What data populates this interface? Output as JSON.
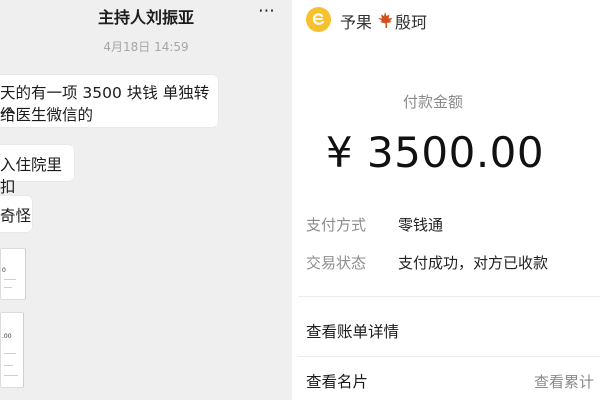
{
  "chat": {
    "title": "主持人刘振亚",
    "more_icon": "⋯",
    "timestamp": "4月18日 14:59",
    "messages": [
      {
        "line1": "天的有一项 3500 块钱 单独转给",
        "line2": "个医生微信的"
      },
      {
        "text": "入住院里扣"
      },
      {
        "text": "奇怪"
      }
    ],
    "thumbnails": [
      {
        "text1": "0",
        "text2": ""
      },
      {
        "text1": ".00",
        "text2": ""
      }
    ]
  },
  "receipt": {
    "merchant_name_part1": "予果",
    "merchant_name_part2": "殷珂",
    "amount_label": "付款金额",
    "amount": "¥ 3500.00",
    "payment_method_label": "支付方式",
    "payment_method_value": "零钱通",
    "status_label": "交易状态",
    "status_value": "支付成功，对方已收款",
    "bill_detail": "查看账单详情",
    "view_card": "查看名片",
    "view_total": "查看累计",
    "colors": {
      "avatar": "#f6c02e",
      "maple": "#d2521e"
    }
  }
}
